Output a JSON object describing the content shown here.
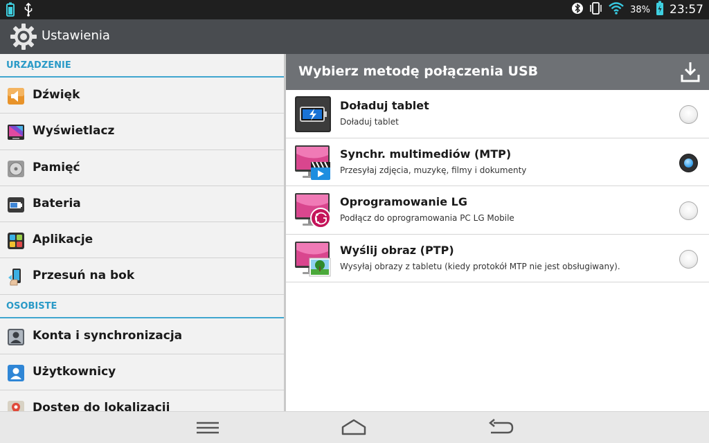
{
  "status_bar": {
    "battery_percent": "38%",
    "time": "23:57"
  },
  "action_bar": {
    "title": "Ustawienia"
  },
  "settings": {
    "sections": [
      {
        "header": "URZĄDZENIE",
        "items": [
          {
            "label": "Dźwięk",
            "icon": "speaker-icon"
          },
          {
            "label": "Wyświetlacz",
            "icon": "display-icon"
          },
          {
            "label": "Pamięć",
            "icon": "storage-icon"
          },
          {
            "label": "Bateria",
            "icon": "battery-icon"
          },
          {
            "label": "Aplikacje",
            "icon": "apps-icon"
          },
          {
            "label": "Przesuń na bok",
            "icon": "slide-aside-icon"
          }
        ]
      },
      {
        "header": "OSOBISTE",
        "items": [
          {
            "label": "Konta i synchronizacja",
            "icon": "accounts-icon"
          },
          {
            "label": "Użytkownicy",
            "icon": "users-icon"
          },
          {
            "label": "Dostęp do lokalizacji",
            "icon": "location-icon"
          }
        ]
      }
    ]
  },
  "usb_dialog": {
    "title": "Wybierz metodę połączenia USB",
    "options": [
      {
        "title": "Doładuj tablet",
        "subtitle": "Doładuj tablet",
        "selected": false
      },
      {
        "title": "Synchr. multimediów (MTP)",
        "subtitle": "Przesyłaj zdjęcia, muzykę, filmy i dokumenty",
        "selected": true
      },
      {
        "title": "Oprogramowanie LG",
        "subtitle": "Podłącz do oprogramowania PC LG Mobile",
        "selected": false
      },
      {
        "title": "Wyślij obraz (PTP)",
        "subtitle": "Wysyłaj obrazy z tabletu (kiedy protokół MTP nie jest obsługiwany).",
        "selected": false
      }
    ]
  },
  "colors": {
    "section_header": "#2a9ac7",
    "action_bar": "#494c50",
    "dialog_header": "#6e7175",
    "radio_selected": "#41a7ef"
  }
}
